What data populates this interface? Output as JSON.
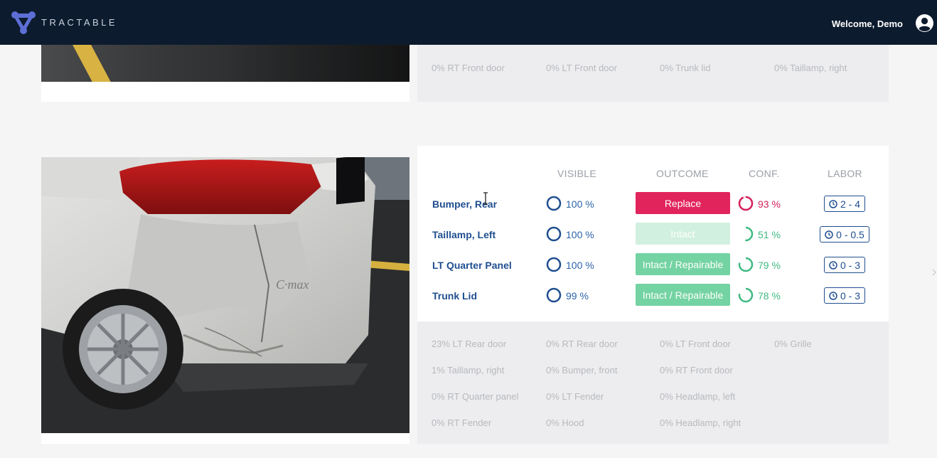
{
  "header": {
    "brand": "TRACTABLE",
    "welcome": "Welcome, Demo"
  },
  "colors": {
    "header_bg": "#0d1b2e",
    "accent_blue": "#1f4e8f",
    "replace": "#e2245c",
    "intact_repairable": "#74d3a2",
    "intact_faded": "#d1f0df",
    "conf_red": "#d4225a",
    "conf_green": "#3fba82"
  },
  "card1": {
    "other_parts": [
      "0% RT Front door",
      "0% LT Front door",
      "0% Trunk lid",
      "0% Taillamp, right"
    ]
  },
  "card2": {
    "columns": {
      "visible": "VISIBLE",
      "outcome": "OUTCOME",
      "conf": "CONF.",
      "labor": "LABOR"
    },
    "rows": [
      {
        "part": "Bumper, Rear",
        "visible": "100 %",
        "visible_fraction": 1.0,
        "outcome": "Replace",
        "outcome_style": "replace",
        "conf": "93 %",
        "conf_fraction": 0.93,
        "labor": "2 - 4"
      },
      {
        "part": "Taillamp, Left",
        "visible": "100 %",
        "visible_fraction": 1.0,
        "outcome": "Intact",
        "outcome_style": "intact_faded",
        "conf": "51 %",
        "conf_fraction": 0.51,
        "labor": "0 - 0.5"
      },
      {
        "part": "LT Quarter Panel",
        "visible": "100 %",
        "visible_fraction": 1.0,
        "outcome": "Intact / Repairable",
        "outcome_style": "intact_repairable",
        "conf": "79 %",
        "conf_fraction": 0.79,
        "labor": "0 - 3"
      },
      {
        "part": "Trunk Lid",
        "visible": "99 %",
        "visible_fraction": 0.99,
        "outcome": "Intact / Repairable",
        "outcome_style": "intact_repairable",
        "conf": "78 %",
        "conf_fraction": 0.78,
        "labor": "0 - 3"
      }
    ],
    "other_parts": [
      [
        "23% LT Rear door",
        "0% RT Rear door",
        "0% LT Front door",
        "0% Grille"
      ],
      [
        "1% Taillamp, right",
        "0% Bumper, front",
        "0% RT Front door"
      ],
      [
        "0% RT Quarter panel",
        "0% LT Fender",
        "0% Headlamp, left"
      ],
      [
        "0% RT Fender",
        "0% Hood",
        "0% Headlamp, right"
      ]
    ]
  }
}
